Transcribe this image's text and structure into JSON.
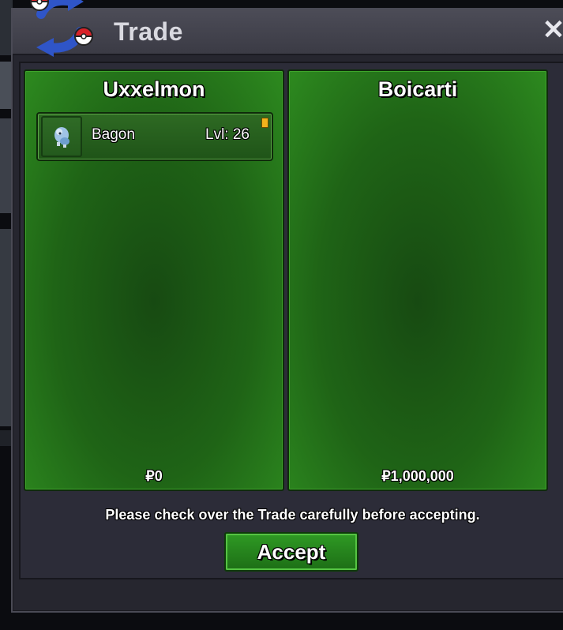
{
  "window": {
    "title": "Trade",
    "close_label": "✕"
  },
  "left_panel": {
    "player": "Uxxelmon",
    "items": [
      {
        "name": "Bagon",
        "level": "Lvl: 26"
      }
    ],
    "money": "₽0"
  },
  "right_panel": {
    "player": "Boicarti",
    "items": [],
    "money": "₽1,000,000"
  },
  "footer": {
    "notice": "Please check over the Trade carefully before accepting.",
    "accept_label": "Accept"
  },
  "colors": {
    "panel_green": "#1f6416",
    "accept_green": "#2f9a24",
    "window_bg": "#26262f"
  }
}
